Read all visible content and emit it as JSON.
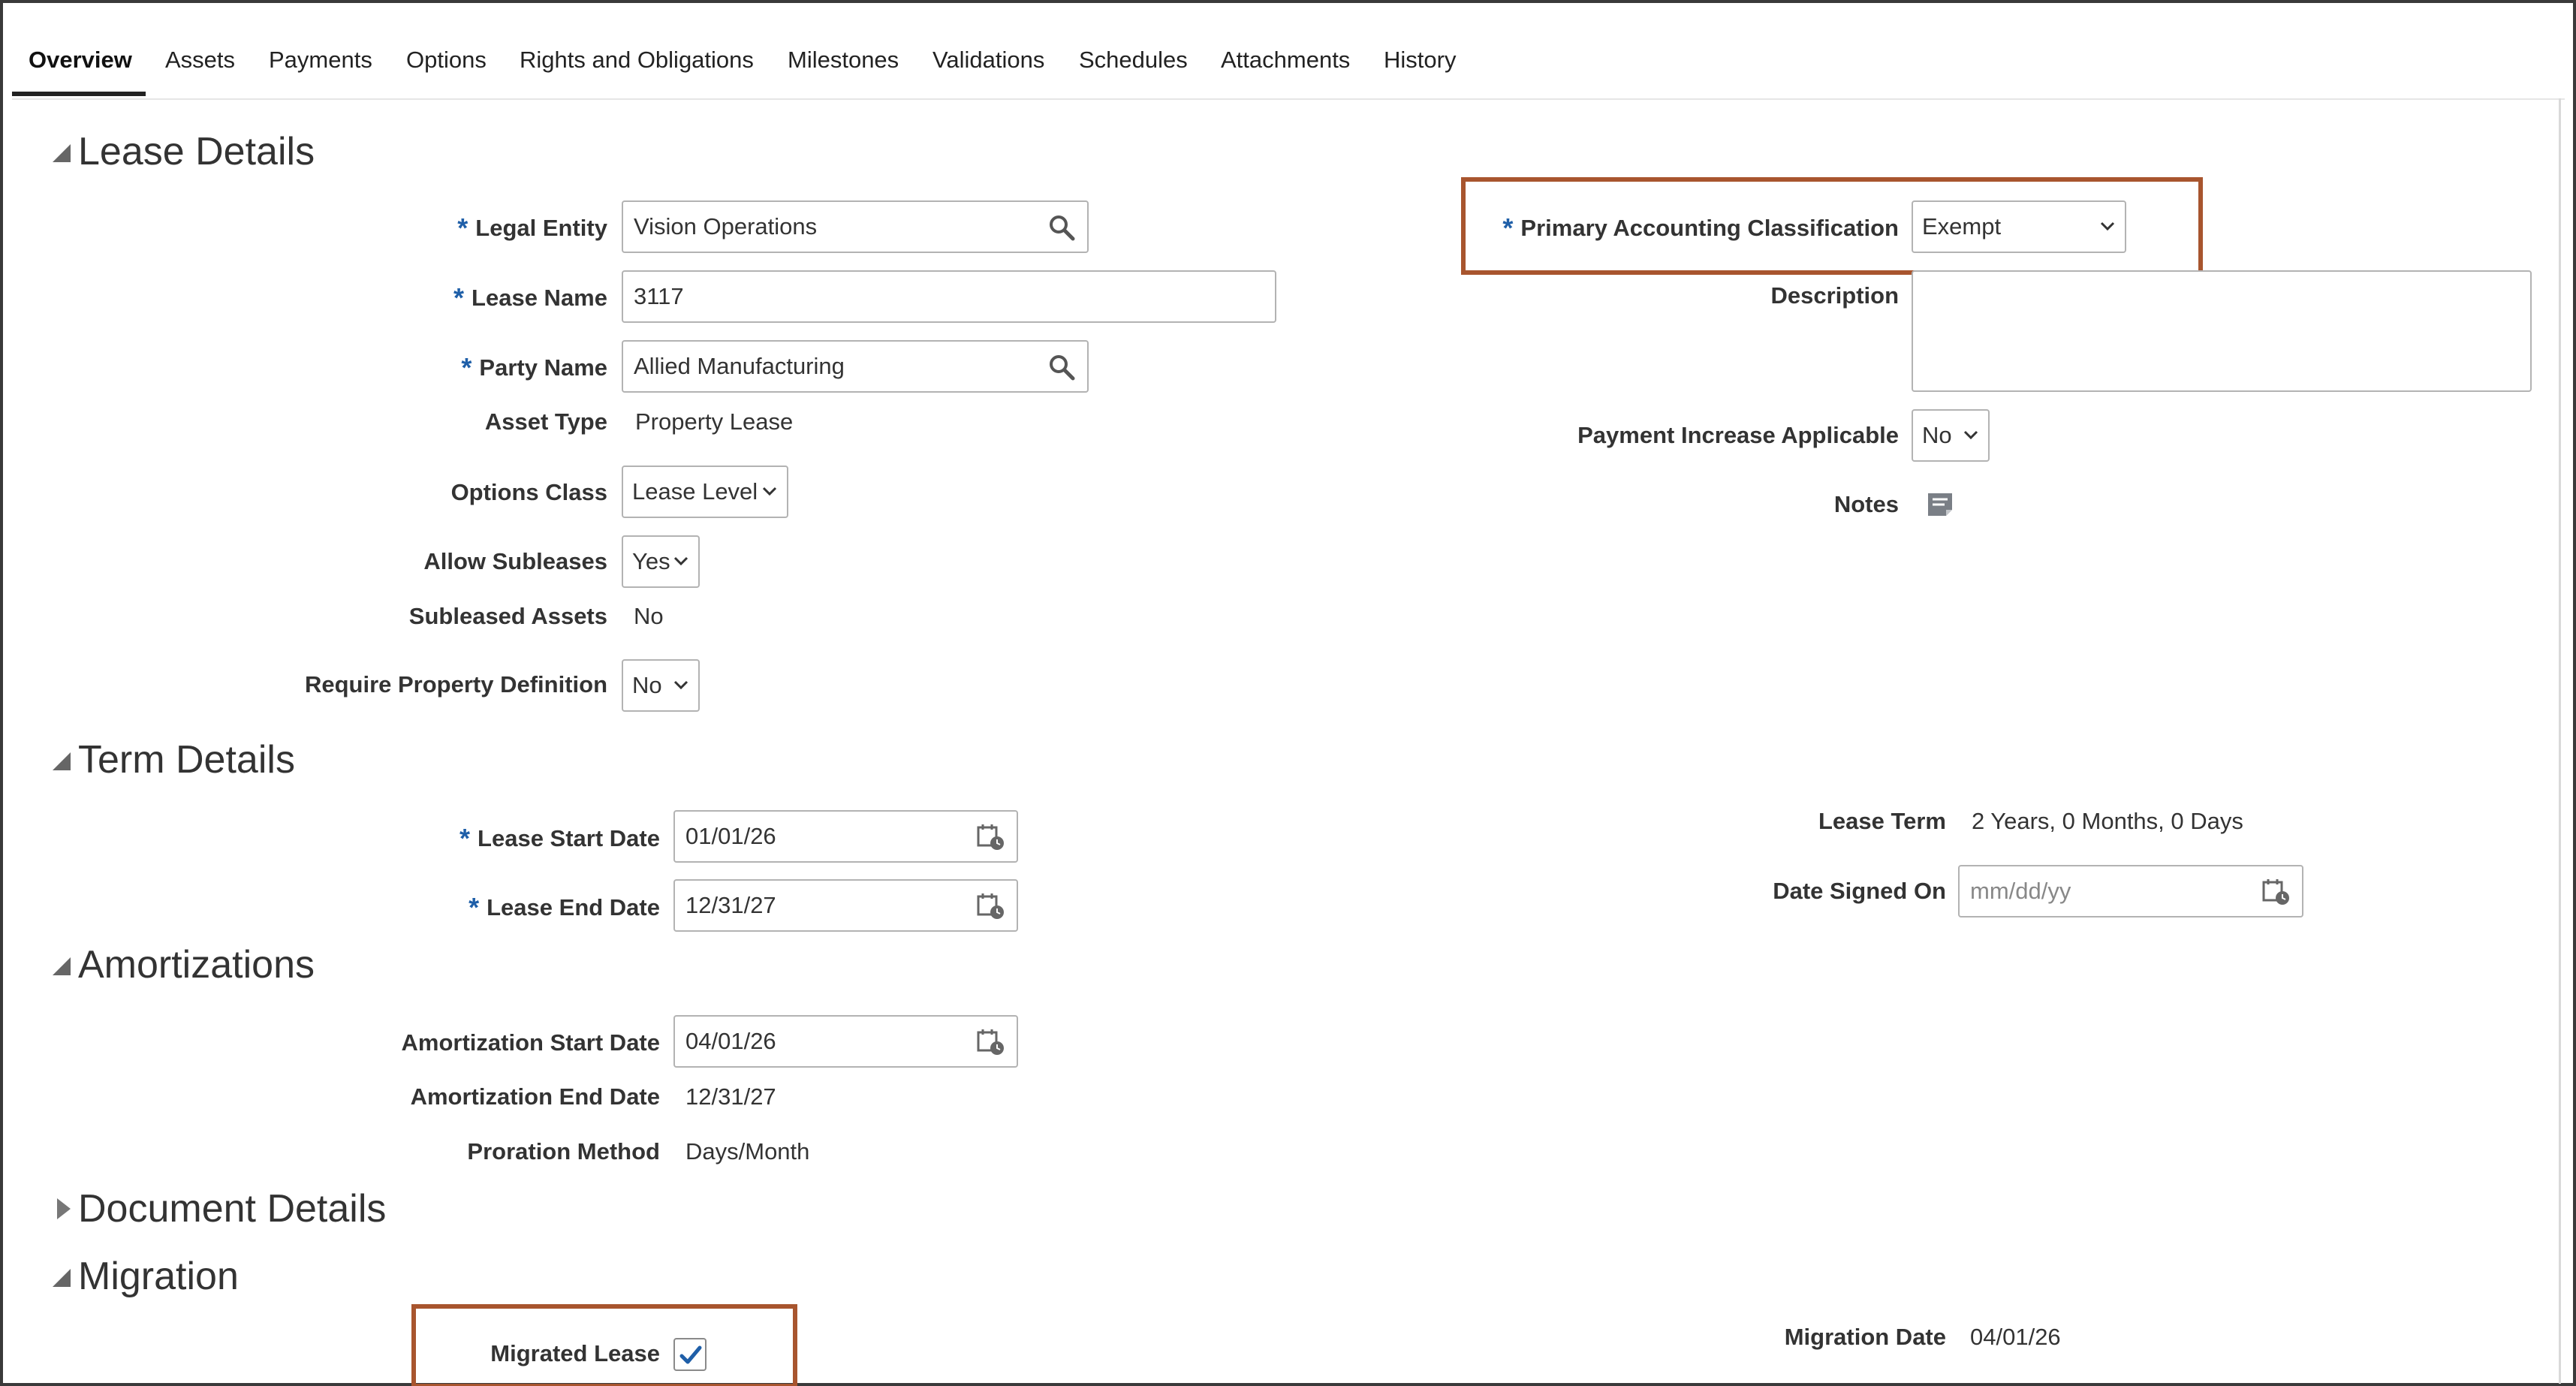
{
  "tabs": [
    "Overview",
    "Assets",
    "Payments",
    "Options",
    "Rights and Obligations",
    "Milestones",
    "Validations",
    "Schedules",
    "Attachments",
    "History"
  ],
  "sections": {
    "lease_details": "Lease Details",
    "term_details": "Term Details",
    "amortizations": "Amortizations",
    "document_details": "Document Details",
    "migration": "Migration"
  },
  "required_marker": "*",
  "lease_details": {
    "legal_entity": {
      "label": "Legal Entity",
      "value": "Vision Operations"
    },
    "lease_name": {
      "label": "Lease Name",
      "value": "3117"
    },
    "party_name": {
      "label": "Party Name",
      "value": "Allied Manufacturing"
    },
    "asset_type": {
      "label": "Asset Type",
      "value": "Property Lease"
    },
    "options_class": {
      "label": "Options Class",
      "value": "Lease Level"
    },
    "allow_subleases": {
      "label": "Allow Subleases",
      "value": "Yes"
    },
    "subleased_assets": {
      "label": "Subleased Assets",
      "value": "No"
    },
    "require_property_definition": {
      "label": "Require Property Definition",
      "value": "No"
    },
    "primary_accounting_classification": {
      "label": "Primary Accounting Classification",
      "value": "Exempt"
    },
    "description": {
      "label": "Description",
      "value": ""
    },
    "payment_increase_applicable": {
      "label": "Payment Increase Applicable",
      "value": "No"
    },
    "notes": {
      "label": "Notes"
    }
  },
  "term_details": {
    "lease_start_date": {
      "label": "Lease Start Date",
      "value": "01/01/26"
    },
    "lease_end_date": {
      "label": "Lease End Date",
      "value": "12/31/27"
    },
    "lease_term": {
      "label": "Lease Term",
      "value": "2 Years, 0 Months, 0 Days"
    },
    "date_signed_on": {
      "label": "Date Signed On",
      "placeholder": "mm/dd/yy"
    }
  },
  "amortizations": {
    "start_date": {
      "label": "Amortization Start Date",
      "value": "04/01/26"
    },
    "end_date": {
      "label": "Amortization End Date",
      "value": "12/31/27"
    },
    "proration_method": {
      "label": "Proration Method",
      "value": "Days/Month"
    }
  },
  "migration": {
    "migrated_lease": {
      "label": "Migrated Lease",
      "checked": true
    },
    "migration_date": {
      "label": "Migration Date",
      "value": "04/01/26"
    }
  },
  "colors": {
    "required": "#1f5fa8",
    "highlight": "#a8552e",
    "check": "#1f5fa8"
  },
  "icons": [
    "search-icon",
    "calendar-icon",
    "notes-icon",
    "chevron-down-icon",
    "checkmark-icon",
    "collapse-triangle-icon",
    "expand-triangle-icon"
  ]
}
